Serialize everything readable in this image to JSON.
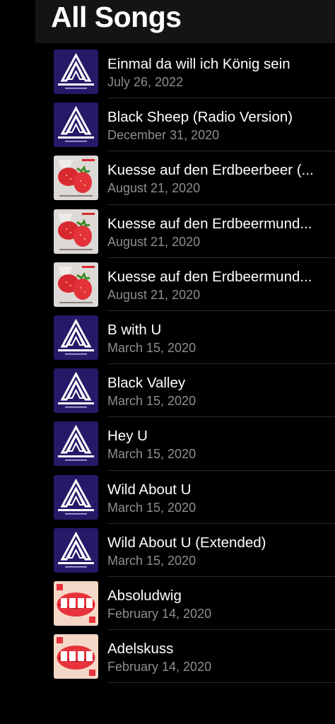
{
  "header": {
    "title": "All Songs"
  },
  "songs": [
    {
      "title": "Einmal da will ich König sein",
      "date": "July 26, 2022",
      "art": "absoludwig-logo-icon"
    },
    {
      "title": "Black Sheep (Radio Version)",
      "date": "December 31, 2020",
      "art": "absoludwig-logo-icon"
    },
    {
      "title": "Kuesse auf den Erdbeerbeer (...",
      "date": "August 21, 2020",
      "art": "strawberry-cover-icon"
    },
    {
      "title": "Kuesse auf den Erdbeermund...",
      "date": "August 21, 2020",
      "art": "strawberry-cover-icon"
    },
    {
      "title": "Kuesse auf den Erdbeermund...",
      "date": "August 21, 2020",
      "art": "strawberry-cover-icon"
    },
    {
      "title": "B with U",
      "date": "March 15, 2020",
      "art": "absoludwig-logo-icon"
    },
    {
      "title": "Black Valley",
      "date": "March 15, 2020",
      "art": "absoludwig-logo-icon"
    },
    {
      "title": "Hey U",
      "date": "March 15, 2020",
      "art": "absoludwig-logo-icon"
    },
    {
      "title": "Wild About U",
      "date": "March 15, 2020",
      "art": "absoludwig-logo-icon"
    },
    {
      "title": "Wild About U (Extended)",
      "date": "March 15, 2020",
      "art": "absoludwig-logo-icon"
    },
    {
      "title": "Absoludwig",
      "date": "February 14, 2020",
      "art": "lips-cover-icon"
    },
    {
      "title": "Adelskuss",
      "date": "February 14, 2020",
      "art": "lips-cover-icon"
    }
  ],
  "colors": {
    "background": "#000000",
    "header": "#141414",
    "title": "#ffffff",
    "subtitle": "#8e8e93",
    "divider": "#2a2a2c",
    "logo_bg": "#241a68"
  }
}
